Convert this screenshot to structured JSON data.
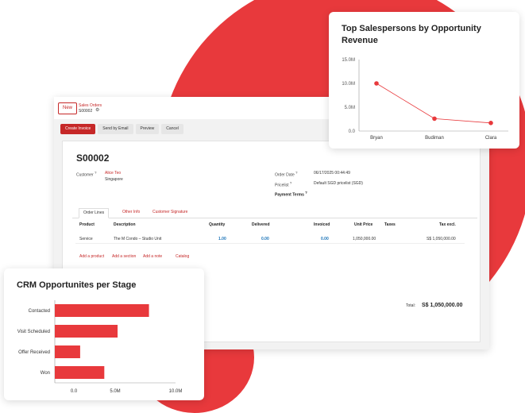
{
  "colors": {
    "accent": "#e8393c",
    "brand_red": "#c62828",
    "link_blue": "#1a73b8"
  },
  "form": {
    "new_label": "New",
    "breadcrumb": "Sales Orders",
    "record_id": "S00002",
    "gear_icon": "gear-icon",
    "actions": [
      "Create Invoice",
      "Send by Email",
      "Preview",
      "Cancel"
    ],
    "title": "S00002",
    "customer_label": "Customer",
    "customer_name": "Alice Teo",
    "customer_city": "Singapore",
    "order_date_label": "Order Date",
    "order_date": "06/17/2025 00:44:49",
    "pricelist_label": "Pricelist",
    "pricelist": "Default SGD pricelist (SGD)",
    "payment_terms_label": "Payment Terms",
    "tabs": [
      "Order Lines",
      "Other Info",
      "Customer Signature"
    ],
    "columns": [
      "Product",
      "Description",
      "Quantity",
      "Delivered",
      "Invoiced",
      "Unit Price",
      "Taxes",
      "Tax excl."
    ],
    "line": {
      "product": "Service",
      "description": "The M Condo – Studio Unit",
      "quantity": "1.00",
      "delivered": "0.00",
      "invoiced": "0.00",
      "unit_price": "1,050,000.00",
      "taxes": "",
      "tax_excl": "S$ 1,050,000.00"
    },
    "add_links": [
      "Add a product",
      "Add a section",
      "Add a note",
      "Catalog"
    ],
    "total_label": "Total:",
    "total_value": "S$ 1,050,000.00"
  },
  "top_sales": {
    "title": "Top Salespersons by Opportunity Revenue",
    "chart_data": {
      "type": "line",
      "title": "Top Salespersons by Opportunity Revenue",
      "categories": [
        "Bryan",
        "Budiman",
        "Clara"
      ],
      "values": [
        10.0,
        2.6,
        1.7
      ],
      "unit": "M",
      "yticks": [
        "0.0",
        "5.0M",
        "10.0M",
        "15.0M"
      ],
      "ylim": [
        0,
        15
      ],
      "grid": false,
      "color": "#e8393c"
    }
  },
  "crm": {
    "title": "CRM Opportunites per Stage",
    "chart_data": {
      "type": "bar",
      "orientation": "horizontal",
      "title": "CRM Opportunites per Stage",
      "categories": [
        "Contacted",
        "Visit Scheduled",
        "Offer Received",
        "Won"
      ],
      "values": [
        7.8,
        5.2,
        2.1,
        4.1
      ],
      "unit": "M",
      "xticks": [
        "0.0",
        "5.0M",
        "10.0M"
      ],
      "xlim": [
        0,
        10
      ],
      "grid": false,
      "color": "#e8393c"
    }
  }
}
